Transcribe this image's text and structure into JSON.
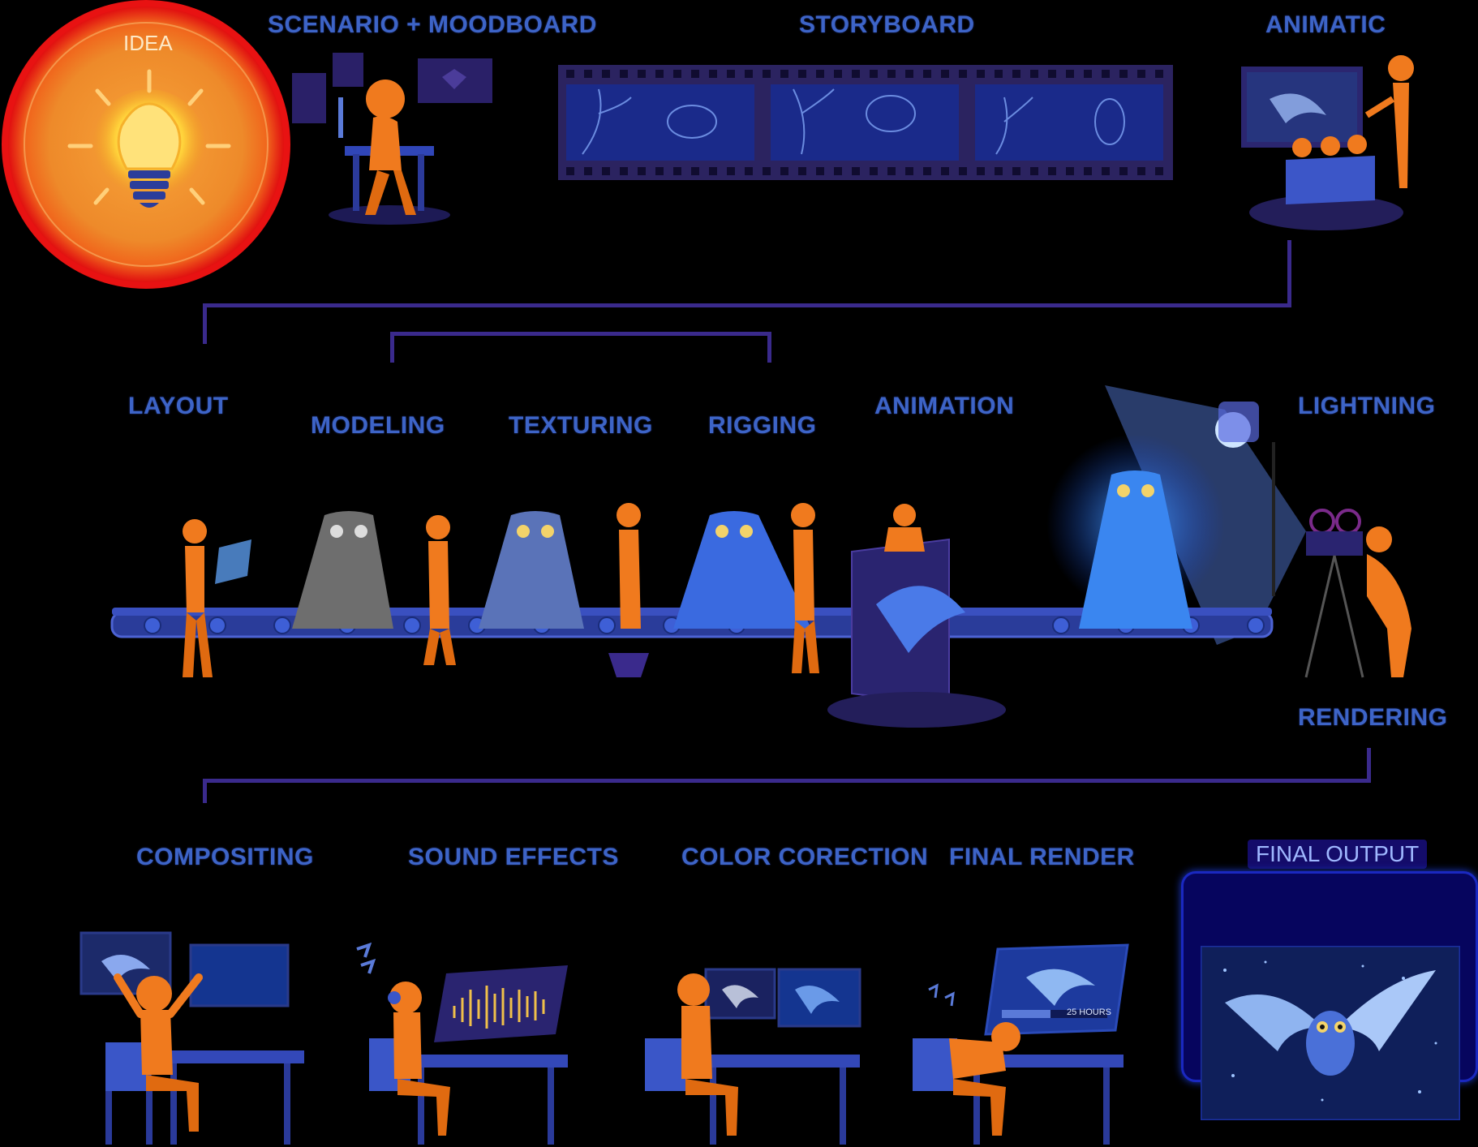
{
  "idea": {
    "label": "IDEA"
  },
  "stages": {
    "scenario": "SCENARIO + MOODBOARD",
    "storyboard": "STORYBOARD",
    "animatic": "ANIMATIC",
    "layout": "LAYOUT",
    "modeling": "MODELING",
    "texturing": "TEXTURING",
    "rigging": "RIGGING",
    "animation": "ANIMATION",
    "lightning": "LIGHTNING",
    "rendering": "RENDERING",
    "compositing": "COMPOSITING",
    "sound_effects": "SOUND EFFECTS",
    "color_correction": "COLOR CORECTION",
    "final_render": "FINAL RENDER",
    "final_output": "FINAL OUTPUT"
  },
  "render_monitor": {
    "time": "25 HOURS"
  },
  "colors": {
    "label": "#3d64c7",
    "connector": "#3a2a8c",
    "person": "#f07a1e",
    "owl": "#3a6ae0",
    "belt": "#2a3c9a"
  }
}
